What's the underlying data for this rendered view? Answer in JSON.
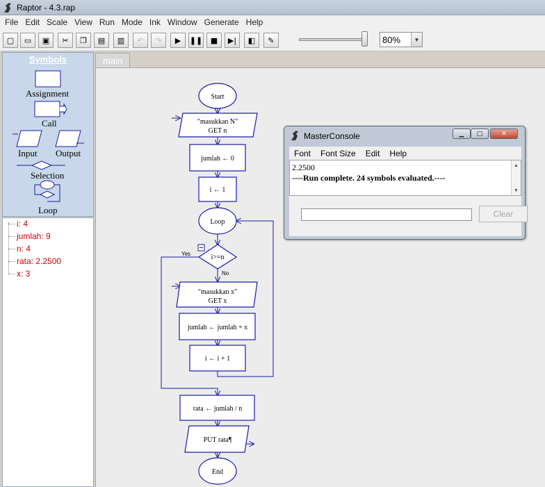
{
  "window": {
    "title": "Raptor - 4.3.rap"
  },
  "menu": [
    "File",
    "Edit",
    "Scale",
    "View",
    "Run",
    "Mode",
    "Ink",
    "Window",
    "Generate",
    "Help"
  ],
  "toolbar": {
    "buttons": [
      {
        "name": "new-icon",
        "glyph": "▢"
      },
      {
        "name": "open-folder-icon",
        "glyph": "▭"
      },
      {
        "name": "save-icon",
        "glyph": "▣"
      },
      {
        "name": "cut-icon",
        "glyph": "✂"
      },
      {
        "name": "copy-icon",
        "glyph": "❐"
      },
      {
        "name": "paste-icon",
        "glyph": "▤"
      },
      {
        "name": "print-icon",
        "glyph": "▥"
      },
      {
        "name": "undo-icon",
        "glyph": "↶"
      },
      {
        "name": "redo-icon",
        "glyph": "↷"
      },
      {
        "name": "play-icon",
        "glyph": "▶"
      },
      {
        "name": "pause-icon",
        "glyph": "❚❚"
      },
      {
        "name": "stop-icon",
        "glyph": "■"
      },
      {
        "name": "step-icon",
        "glyph": "▶|"
      },
      {
        "name": "test-server-icon",
        "glyph": "◧"
      },
      {
        "name": "pen-icon",
        "glyph": "✎"
      }
    ],
    "zoom": "80%",
    "speed_level": 0.95
  },
  "palette": {
    "heading": "Symbols",
    "labels": {
      "assignment": "Assignment",
      "call": "Call",
      "input": "Input",
      "output": "Output",
      "selection": "Selection",
      "loop": "Loop"
    }
  },
  "variables": [
    "i: 4",
    "jumlah: 9",
    "n: 4",
    "rata: 2.2500",
    "x: 3"
  ],
  "tab": "main",
  "flowchart": {
    "start": "Start",
    "input_n_prompt": "\"masukkan N\"",
    "input_n_get": "GET n",
    "assign_jumlah": "jumlah ← 0",
    "assign_i": "i ← 1",
    "loop": "Loop",
    "condition": "i>=n",
    "yes": "Yes",
    "no": "No",
    "input_x_prompt": "\"masukkan x\"",
    "input_x_get": "GET x",
    "assign_sum": "jumlah ← jumlah + x",
    "assign_inc": "i ← i + 1",
    "assign_rata": "rata ← jumlah / n",
    "output": "PUT rata¶",
    "end": "End"
  },
  "console": {
    "title": "MasterConsole",
    "menu": [
      "Font",
      "Font Size",
      "Edit",
      "Help"
    ],
    "output": [
      "2.2500",
      "----Run complete.  24 symbols evaluated.----"
    ],
    "clear": "Clear"
  },
  "colors": {
    "accent_blue": "#1a1aa6",
    "variable_red": "#cc0000"
  }
}
